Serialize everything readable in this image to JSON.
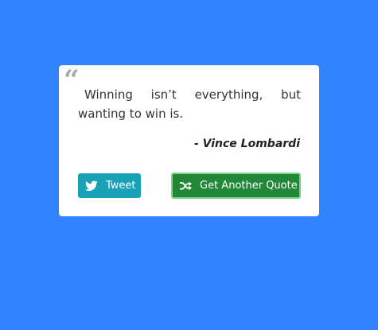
{
  "quote": {
    "mark_icon": "left-double-quote-icon",
    "mark_glyph": "“",
    "text": "Winning isn’t everything, but wanting to win is.",
    "author": "- Vince Lombardi"
  },
  "buttons": {
    "tweet_label": "Tweet",
    "tweet_icon": "twitter-icon",
    "new_quote_label": "Get Another Quote",
    "new_quote_icon": "shuffle-icon"
  },
  "colors": {
    "background": "#3183ff",
    "card": "#ffffff",
    "tweet_button": "#17a2b8",
    "new_quote_button": "#218838",
    "new_quote_focus_ring": "#7ed58d"
  }
}
